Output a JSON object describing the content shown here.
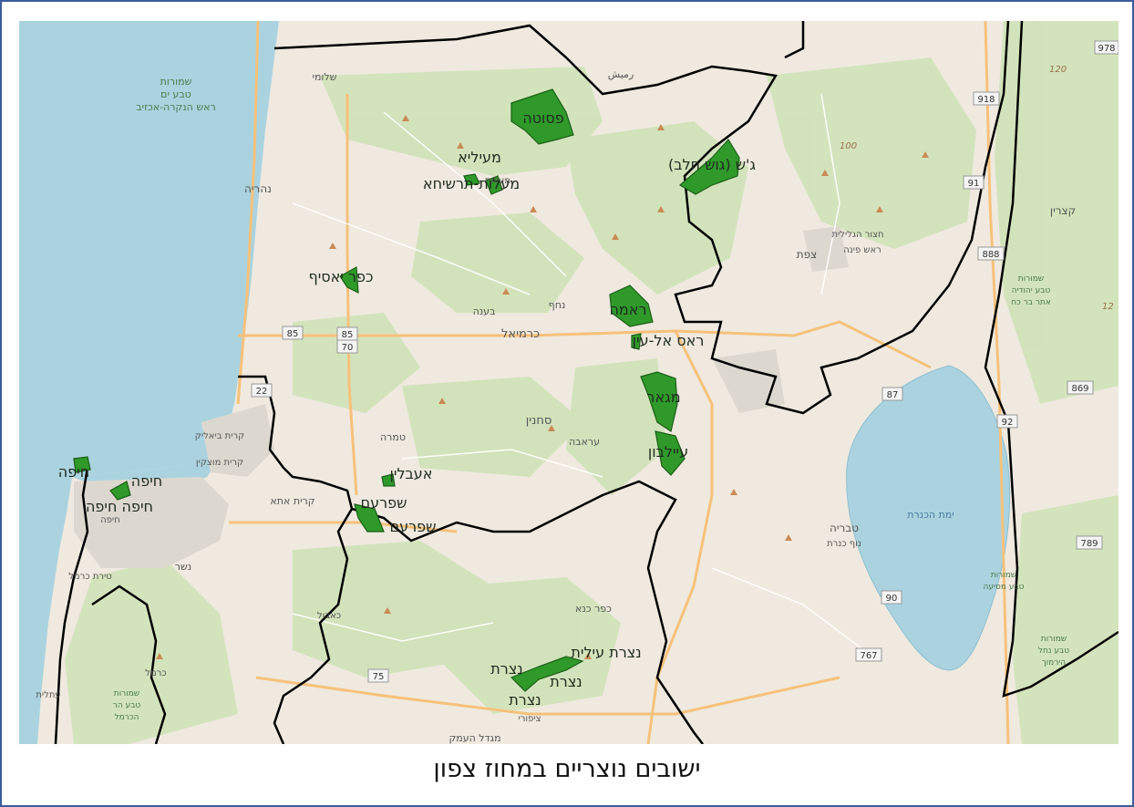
{
  "caption": "ישובים נוצריים במחוז צפון",
  "christian_settlements": [
    {
      "name": "פסוטה"
    },
    {
      "name": "מעיליא"
    },
    {
      "name": "מעלות-תרשיחא"
    },
    {
      "name": "ג'ש (גוש חלב)"
    },
    {
      "name": "כפר יאסיף"
    },
    {
      "name": "ראמה"
    },
    {
      "name": "ראס אל-עין"
    },
    {
      "name": "מגאר"
    },
    {
      "name": "עיילבון"
    },
    {
      "name": "חיפה"
    },
    {
      "name": "חיפה"
    },
    {
      "name": "חיפה חיפה"
    },
    {
      "name": "אעבלין"
    },
    {
      "name": "שפרעם"
    },
    {
      "name": "שפרעם"
    },
    {
      "name": "נצרת עילית"
    },
    {
      "name": "נצרת"
    },
    {
      "name": "נצרת"
    },
    {
      "name": "נצרת"
    }
  ],
  "basemap_labels": {
    "reserve_sea": [
      "שמורות",
      "טבע ים",
      "ראש הנקרה-אכזיב"
    ],
    "shlomi": "שלומי",
    "nahariya": "נהריה",
    "karmiel": "כרמיאל",
    "bina": "בענה",
    "nahf": "נחף",
    "sakhnin": "סחנין",
    "arraba": "עראבה",
    "tamra": "טמרה",
    "kiryat_ata": "קרית אתא",
    "kiryat_bialik": "קרית ביאליק",
    "kiryat_motzkin": "קרית מוצקין",
    "haifa_city": "חיפה",
    "nesher": "נשר",
    "tirat_carmel": "טירת כרמל",
    "atlit": "עתלית",
    "kfar_kana": "כפר כנא",
    "migdal_haemek": "מגדל העמק",
    "tiberias": "טבריה",
    "kinneret_lake": "ימת הכנרת",
    "tzfat": "צפת",
    "hatzor": "חצור הגלילית",
    "rosh_pina": "ראש פינה",
    "katzrin": "קצרין",
    "nof_kinneret": "נוף כנרת",
    "yokneam_area": "כרמל",
    "reserve_carmel": [
      "שמורות",
      "טבע הר",
      "הכרמל"
    ],
    "reserve_golan": [
      "שמורות",
      "טבע יהודיה",
      "אתר בר כח"
    ],
    "reserve_yarmouk": [
      "שמורות",
      "טבע נחל",
      "הירמוך"
    ],
    "reserve_mesh": [
      "שמורות",
      "טבע מסיעה"
    ],
    "rmeish": "رميش",
    "nazareth_area": "ציפורי",
    "kabul": "כאבול",
    "zalafa": "מעלות"
  },
  "road_numbers": [
    "85",
    "85",
    "70",
    "22",
    "87",
    "90",
    "92",
    "869",
    "789",
    "767",
    "75",
    "888",
    "918",
    "91",
    "978"
  ],
  "elevations": [
    "120",
    "100",
    "12"
  ],
  "colors": {
    "settlement_fill": "#2f9a2a",
    "settlement_stroke": "#1b5e17",
    "sea": "#aad3df",
    "land": "#efe9df",
    "forest": "#c7dfb0",
    "boundary": "#000000",
    "frame": "#3a5c9c"
  }
}
